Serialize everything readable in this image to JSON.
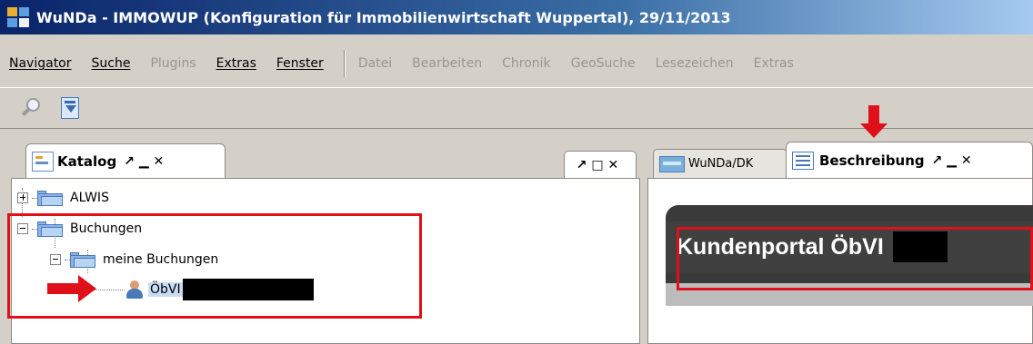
{
  "window": {
    "title": "WuNDa - IMMOWUP (Konfiguration für Immobilienwirtschaft Wuppertal), 29/11/2013"
  },
  "menu": {
    "enabled": [
      "Navigator",
      "Suche"
    ],
    "disabled_mid": [
      "Plugins"
    ],
    "enabled2": [
      "Extras",
      "Fenster"
    ],
    "disabled": [
      "Datei",
      "Bearbeiten",
      "Chronik",
      "GeoSuche",
      "Lesezeichen",
      "Extras"
    ]
  },
  "toolbar": {
    "icons": [
      "search-icon",
      "download-icon"
    ]
  },
  "left_panel": {
    "tab": {
      "label": "Katalog",
      "controls": "↗ ▁ ✕"
    },
    "corner_controls": "↗ □ ✕",
    "tree": {
      "alwis": "ALWIS",
      "buchungen": "Buchungen",
      "meine_buchungen": "meine Buchungen",
      "obvi": "ÖbVI"
    }
  },
  "right_panel": {
    "tab_inactive": "WuNDa/DK",
    "tab_active": {
      "label": "Beschreibung",
      "controls": "↗ ▁ ✕"
    },
    "portal_title": "Kundenportal ÖbVI"
  },
  "colors": {
    "annotation_red": "#e0101a",
    "title_bar": "#0a246a",
    "portal_bg": "#3a3a3a"
  }
}
